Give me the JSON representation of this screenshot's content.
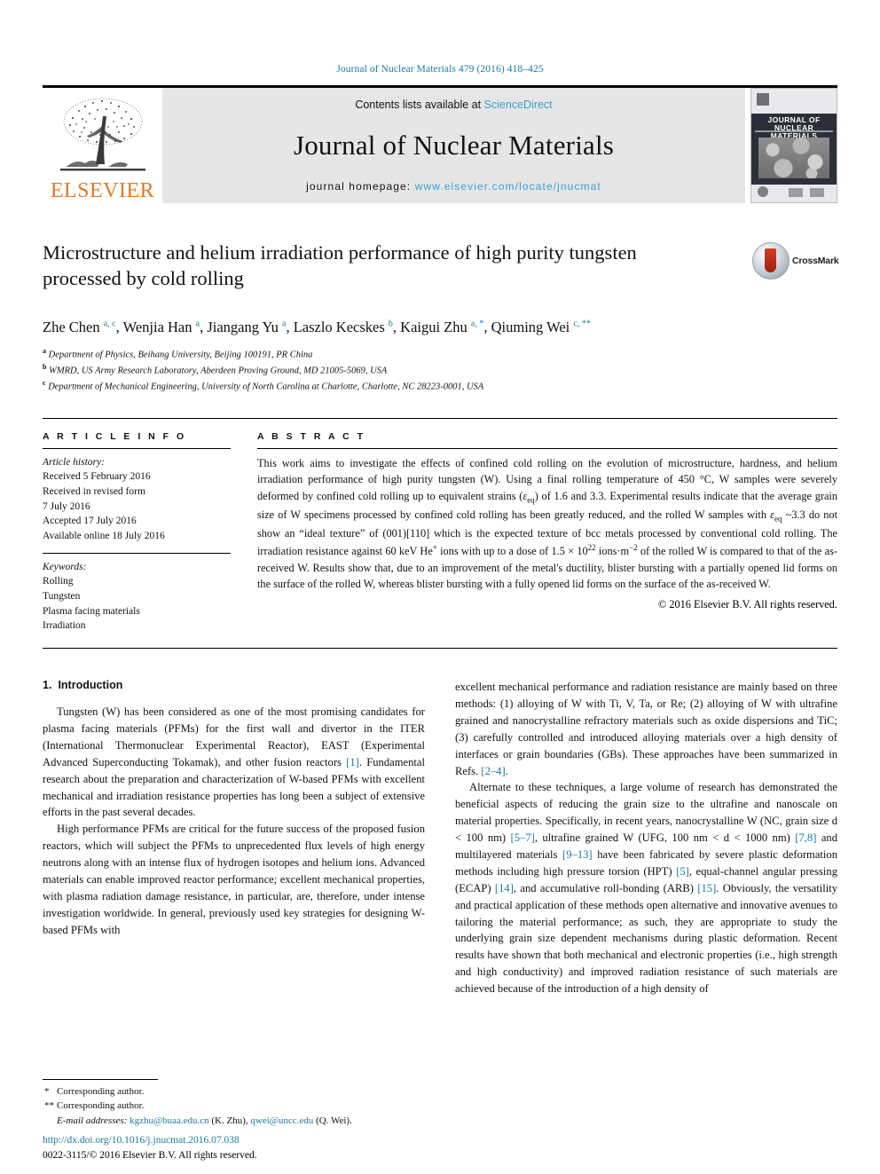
{
  "running_head": "Journal of Nuclear Materials 479 (2016) 418–425",
  "masthead": {
    "publisher": "ELSEVIER",
    "contents_prefix": "Contents lists available at ",
    "contents_link": "ScienceDirect",
    "journal_title": "Journal of Nuclear Materials",
    "homepage_prefix": "journal homepage: ",
    "homepage_url": "www.elsevier.com/locate/jnucmat",
    "cover": {
      "line1": "JOURNAL OF",
      "line2": "NUCLEAR MATERIALS"
    }
  },
  "article": {
    "title": "Microstructure and helium irradiation performance of high purity tungsten processed by cold rolling",
    "crossmark_label": "CrossMark",
    "authors_html": "Zhe Chen <sup>a, c</sup>, Wenjia Han <sup>a</sup>, Jiangang Yu <sup>a</sup>, Laszlo Kecskes <sup>b</sup>, Kaigui Zhu <sup>a, *</sup>, Qiuming Wei <sup>c, **</sup>",
    "affiliations": [
      {
        "mark": "a",
        "text": "Department of Physics, Beihang University, Beijing 100191, PR China"
      },
      {
        "mark": "b",
        "text": "WMRD, US Army Research Laboratory, Aberdeen Proving Ground, MD 21005-5069, USA"
      },
      {
        "mark": "c",
        "text": "Department of Mechanical Engineering, University of North Carolina at Charlotte, Charlotte, NC 28223-0001, USA"
      }
    ]
  },
  "article_info": {
    "heading": "A R T I C L E  I N F O",
    "history_label": "Article history:",
    "history": [
      "Received 5 February 2016",
      "Received in revised form",
      "7 July 2016",
      "Accepted 17 July 2016",
      "Available online 18 July 2016"
    ],
    "keywords_label": "Keywords:",
    "keywords": [
      "Rolling",
      "Tungsten",
      "Plasma facing materials",
      "Irradiation"
    ]
  },
  "abstract": {
    "heading": "A B S T R A C T",
    "html": "This work aims to investigate the effects of confined cold rolling on the evolution of microstructure, hardness, and helium irradiation performance of high purity tungsten (W). Using a final rolling temperature of 450 &deg;C, W samples were severely deformed by confined cold rolling up to equivalent strains (<i>&epsilon;</i><sub>eq</sub>) of 1.6 and 3.3. Experimental results indicate that the average grain size of W specimens processed by confined cold rolling has been greatly reduced, and the rolled W samples with <i>&epsilon;</i><sub>eq</sub> ~3.3 do not show an “ideal texture” of (001)[110] which is the expected texture of bcc metals processed by conventional cold rolling. The irradiation resistance against 60 keV He<sup>+</sup> ions with up to a dose of 1.5 &times; 10<sup>22</sup> ions&middot;m<sup>&minus;2</sup> of the rolled W is compared to that of the as-received W. Results show that, due to an improvement of the metal's ductility, blister bursting with a partially opened lid forms on the surface of the rolled W, whereas blister bursting with a fully opened lid forms on the surface of the as-received W.",
    "copyright": "© 2016 Elsevier B.V. All rights reserved."
  },
  "introduction": {
    "number": "1.",
    "title": "Introduction",
    "left_paragraphs_html": [
      "Tungsten (W) has been considered as one of the most promising candidates for plasma facing materials (PFMs) for the first wall and divertor in the ITER (International Thermonuclear Experimental Reactor), EAST (Experimental Advanced Superconducting Tokamak), and other fusion reactors <span class=\"ref\">[1]</span>. Fundamental research about the preparation and characterization of W-based PFMs with excellent mechanical and irradiation resistance properties has long been a subject of extensive efforts in the past several decades.",
      "High performance PFMs are critical for the future success of the proposed fusion reactors, which will subject the PFMs to unprecedented flux levels of high energy neutrons along with an intense flux of hydrogen isotopes and helium ions. Advanced materials can enable improved reactor performance; excellent mechanical properties, with plasma radiation damage resistance, in particular, are, therefore, under intense investigation worldwide. In general, previously used key strategies for designing W-based PFMs with"
    ],
    "right_paragraphs_html": [
      "excellent mechanical performance and radiation resistance are mainly based on three methods: (1) alloying of W with Ti, V, Ta, or Re; (2) alloying of W with ultrafine grained and nanocrystalline refractory materials such as oxide dispersions and TiC; (3) carefully controlled and introduced alloying materials over a high density of interfaces or grain boundaries (GBs). These approaches have been summarized in Refs. <span class=\"ref\">[2&ndash;4]</span>.",
      "Alternate to these techniques, a large volume of research has demonstrated the beneficial aspects of reducing the grain size to the ultrafine and nanoscale on material properties. Specifically, in recent years, nanocrystalline W (NC, grain size d &lt; 100 nm) <span class=\"ref\">[5&ndash;7]</span>, ultrafine grained W (UFG, 100 nm &lt; d &lt; 1000 nm) <span class=\"ref\">[7,8]</span> and multilayered materials <span class=\"ref\">[9&ndash;13]</span> have been fabricated by severe plastic deformation methods including high pressure torsion (HPT) <span class=\"ref\">[5]</span>, equal-channel angular pressing (ECAP) <span class=\"ref\">[14]</span>, and accumulative roll-bonding (ARB) <span class=\"ref\">[15]</span>. Obviously, the versatility and practical application of these methods open alternative and innovative avenues to tailoring the material performance; as such, they are appropriate to study the underlying grain size dependent mechanisms during plastic deformation. Recent results have shown that both mechanical and electronic properties (i.e., high strength and high conductivity) and improved radiation resistance of such materials are achieved because of the introduction of a high density of"
    ]
  },
  "footnotes": {
    "corresponding_1": "Corresponding author.",
    "corresponding_2": "Corresponding author.",
    "email_label": "E-mail addresses:",
    "email_1": "kgzhu@buaa.edu.cn",
    "email_1_name": "(K. Zhu),",
    "email_2": "qwei@uncc.edu",
    "email_2_name": "(Q. Wei)."
  },
  "footer": {
    "doi": "http://dx.doi.org/10.1016/j.jnucmat.2016.07.038",
    "issn_line": "0022-3115/© 2016 Elsevier B.V. All rights reserved."
  },
  "colors": {
    "link": "#1a7aa8",
    "sciencedirect": "#3aa0d1",
    "elsevier_orange": "#E87722",
    "masthead_bg": "#e6e6e6"
  }
}
